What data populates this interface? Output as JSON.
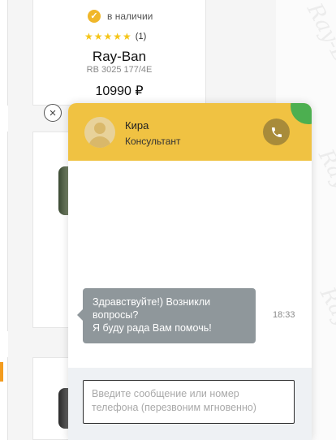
{
  "product": {
    "stock_label": "в наличии",
    "rating_stars": "★★★★★",
    "rating_count": "(1)",
    "brand": "Ray-Ban",
    "model": "RB 3025 177/4E",
    "price": "10990 ₽"
  },
  "watermark": {
    "text": "Ray-Ban"
  },
  "chat": {
    "close_icon": "×",
    "agent_name": "Кира",
    "agent_role": "Консультант",
    "message_lines": [
      "Здравствуйте!) Возникли",
      "вопросы?",
      "Я буду рада Вам помочь!"
    ],
    "message_time": "18:33",
    "input_placeholder": "Введите сообщение или номер телефона (перезвоним мгновенно)"
  },
  "colors": {
    "header": "#f0c242",
    "bubble": "#8f979b",
    "call_button": "#a88b3a",
    "online_corner": "#4caf50",
    "stock_check": "#f0b72a"
  },
  "icons": {
    "close": "close-icon",
    "call": "phone-icon",
    "avatar": "user-avatar-icon",
    "stock": "check-circle-icon"
  }
}
